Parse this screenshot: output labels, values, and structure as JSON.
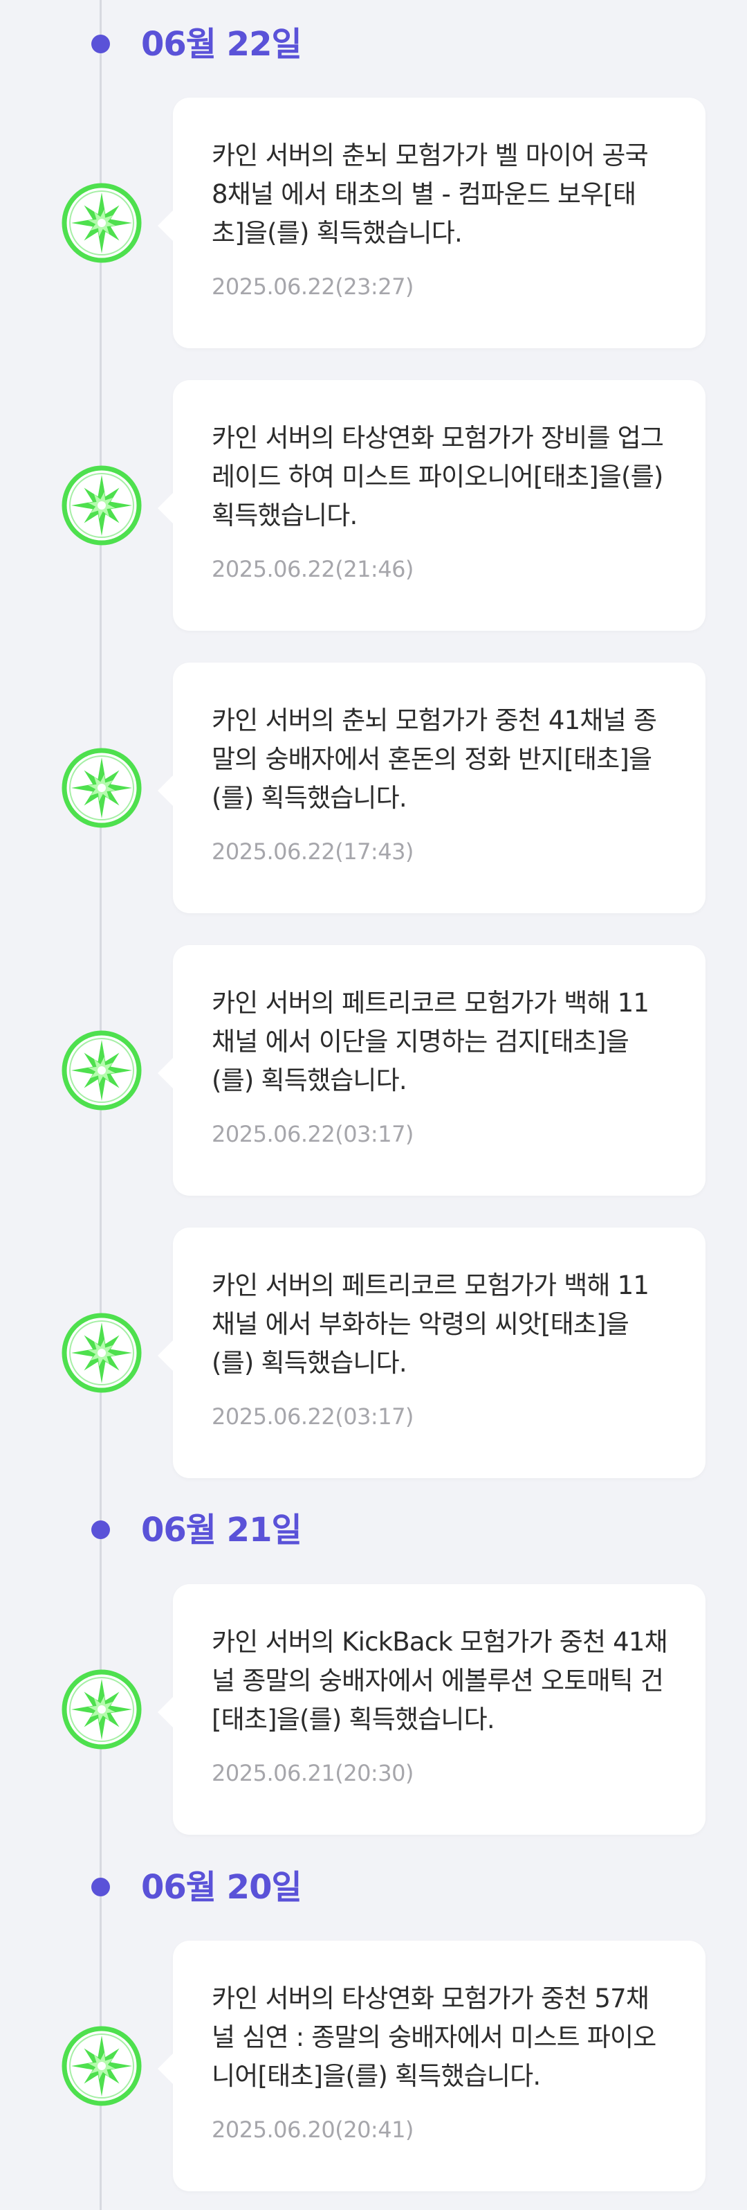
{
  "colors": {
    "accent": "#5a52d8",
    "icon_green": "#4ee04e",
    "background": "#f2f3f7",
    "card": "#ffffff",
    "timestamp": "#a6a6ab"
  },
  "icon": "green-star-emblem-icon",
  "groups": [
    {
      "date": "06월 22일",
      "entries": [
        {
          "message": "카인 서버의 춘뇌 모험가가 벨 마이어 공국 8채널 에서 태초의 별 - 컴파운드 보우[태초]을(를) 획득했습니다.",
          "time": "2025.06.22(23:27)"
        },
        {
          "message": "카인 서버의 타상연화 모험가가 장비를 업그레이드 하여 미스트 파이오니어[태초]을(를) 획득했습니다.",
          "time": "2025.06.22(21:46)"
        },
        {
          "message": "카인 서버의 춘뇌 모험가가 중천 41채널 종말의 숭배자에서 혼돈의 정화 반지[태초]을(를) 획득했습니다.",
          "time": "2025.06.22(17:43)"
        },
        {
          "message": "카인 서버의 페트리코르 모험가가 백해 11채널 에서 이단을 지명하는 검지[태초]을(를) 획득했습니다.",
          "time": "2025.06.22(03:17)"
        },
        {
          "message": "카인 서버의 페트리코르 모험가가 백해 11채널 에서 부화하는 악령의 씨앗[태초]을(를) 획득했습니다.",
          "time": "2025.06.22(03:17)"
        }
      ]
    },
    {
      "date": "06월 21일",
      "entries": [
        {
          "message": "카인 서버의 KickBack 모험가가 중천 41채널 종말의 숭배자에서 에볼루션 오토매틱 건[태초]을(를) 획득했습니다.",
          "time": "2025.06.21(20:30)"
        }
      ]
    },
    {
      "date": "06월 20일",
      "entries": [
        {
          "message": "카인 서버의 타상연화 모험가가 중천 57채널 심연 : 종말의 숭배자에서 미스트 파이오니어[태초]을(를) 획득했습니다.",
          "time": "2025.06.20(20:41)"
        }
      ]
    }
  ]
}
